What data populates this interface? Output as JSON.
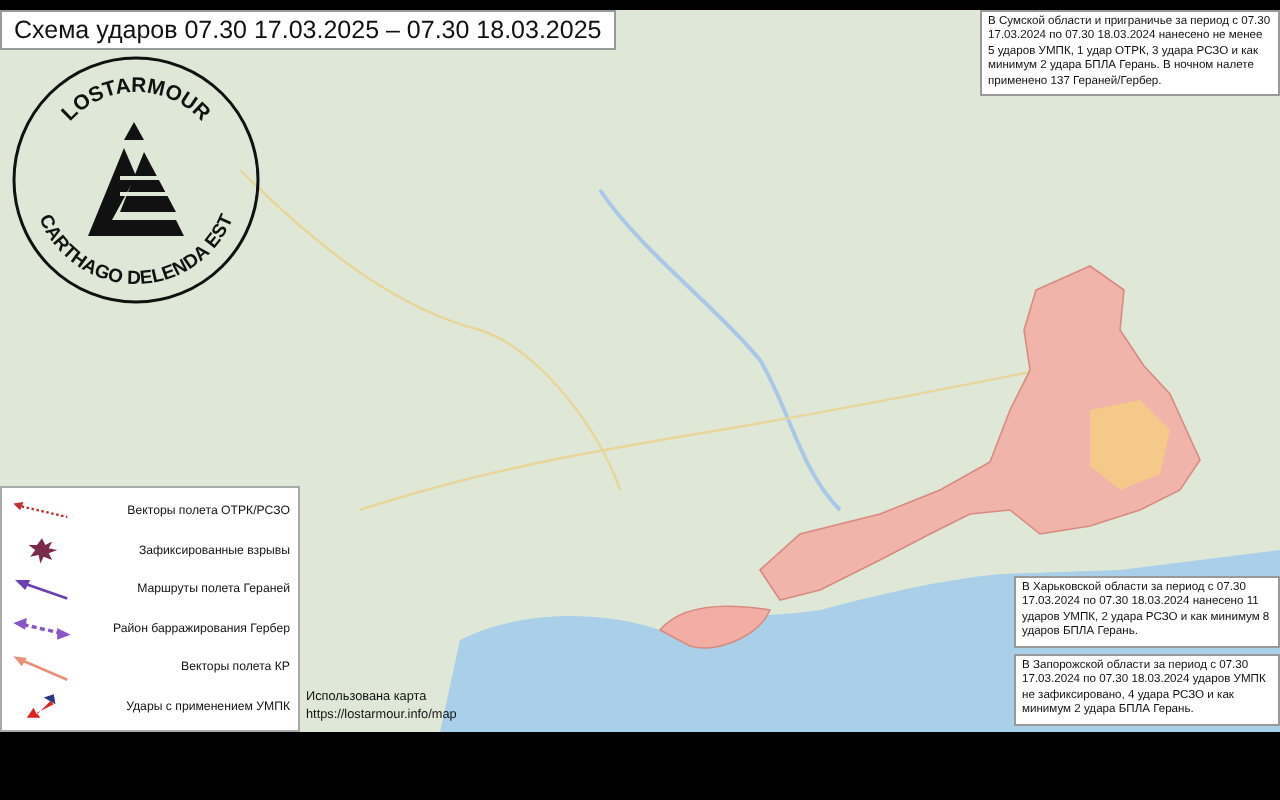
{
  "title": "Схема ударов  07.30 17.03.2025 – 07.30 18.03.2025",
  "logo": {
    "top_text": "LOSTARMOUR",
    "bottom_text": "CARTHAGO DELENDA EST"
  },
  "notes": [
    {
      "text": "В Сумской области и приграничье  за период с 07.30 17.03.2024 по 07.30 18.03.2024 нанесено не менее 5 ударов УМПК, 1 удар ОТРК, 3 удара РСЗО и как минимум 2 удара БПЛА Герань. В ночном налете применено 137 Гераней/Гербер."
    },
    {
      "text": "В Харьковской области за период с 07.30 17.03.2024  по 07.30 18.03.2024 нанесено 11 ударов УМПК, 2 удара РСЗО и как минимум 8 ударов БПЛА Герань."
    },
    {
      "text": "В Запорожской области за период с 07.30 17.03.2024  по 07.30 18.03.2024 ударов УМПК не зафиксировано, 4 удара РСЗО и как минимум 2 удара БПЛА Герань."
    }
  ],
  "legend": [
    {
      "kind": "dotted",
      "label": "Векторы полета ОТРК/РСЗО"
    },
    {
      "kind": "burst",
      "label": "Зафиксированные взрывы"
    },
    {
      "kind": "route",
      "label": "Маршруты полета Гераней"
    },
    {
      "kind": "loiter",
      "label": "Район барражирования Гербер"
    },
    {
      "kind": "cruise",
      "label": "Векторы полета КР"
    },
    {
      "kind": "bomb",
      "label": "Удары с применением УМПК"
    }
  ],
  "attribution": {
    "line_1": "Использована карта",
    "line_2": "https://lostarmour.info/map"
  }
}
